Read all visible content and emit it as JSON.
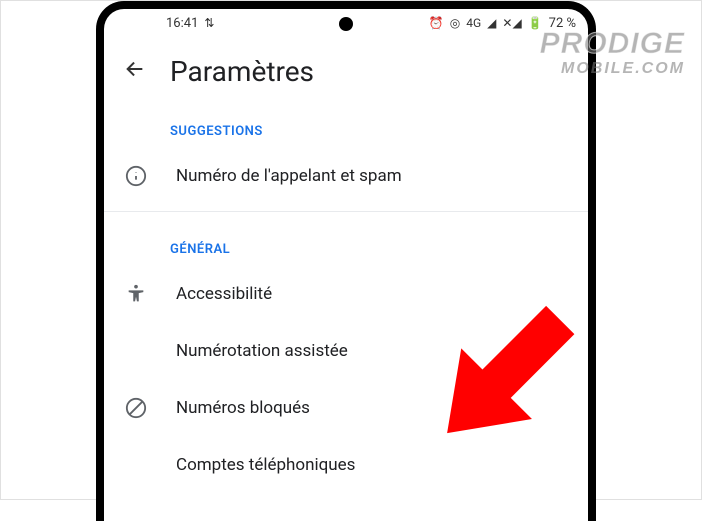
{
  "status_bar": {
    "time": "16:41",
    "network_label": "4G",
    "battery_percent": "72 %"
  },
  "header": {
    "title": "Paramètres"
  },
  "sections": {
    "suggestions_label": "SUGGESTIONS",
    "general_label": "GÉNÉRAL"
  },
  "items": {
    "caller_spam": "Numéro de l'appelant et spam",
    "accessibility": "Accessibilité",
    "assisted_dialing": "Numérotation assistée",
    "blocked_numbers": "Numéros bloqués",
    "phone_accounts": "Comptes téléphoniques"
  },
  "watermark": {
    "line1": "PRODIGE",
    "line2": "MOBILE.COM"
  }
}
